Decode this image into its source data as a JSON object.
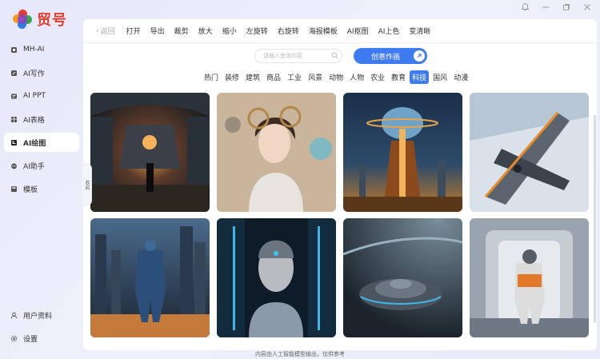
{
  "app": {
    "logo_text": "贸号"
  },
  "window": {
    "minimize": "—",
    "maximize": "❐",
    "close": "✕",
    "pin": "♫"
  },
  "sidebar": {
    "items": [
      {
        "label": "MH-AI",
        "icon": "chip-icon"
      },
      {
        "label": "AI写作",
        "icon": "pen-icon"
      },
      {
        "label": "AI PPT",
        "icon": "slides-icon"
      },
      {
        "label": "AI表格",
        "icon": "table-icon"
      },
      {
        "label": "AI绘图",
        "icon": "paint-icon",
        "active": true
      },
      {
        "label": "AI助手",
        "icon": "robot-icon"
      },
      {
        "label": "模板",
        "icon": "template-icon"
      }
    ],
    "bottom": [
      {
        "label": "用户资料",
        "icon": "user-icon"
      },
      {
        "label": "设置",
        "icon": "gear-icon"
      }
    ]
  },
  "toolbar": {
    "back": "返回",
    "items": [
      "打开",
      "导出",
      "裁剪",
      "放大",
      "缩小",
      "左旋转",
      "右旋转",
      "海报模板",
      "AI抠图",
      "AI上色",
      "变清晰"
    ]
  },
  "search": {
    "placeholder": "请输入查询内容"
  },
  "create_button": {
    "label": "创意作画"
  },
  "categories": {
    "items": [
      "热门",
      "装修",
      "建筑",
      "商品",
      "工业",
      "风景",
      "动物",
      "人物",
      "农业",
      "教育",
      "科技",
      "国风",
      "动漫"
    ],
    "active": "科技"
  },
  "collapse_tab": {
    "label": "收起"
  },
  "footer": {
    "notice": "内容由人工智能模型输出，仅供参考"
  },
  "colors": {
    "accent": "#3f7bf0",
    "brand": "#e23d2e"
  }
}
